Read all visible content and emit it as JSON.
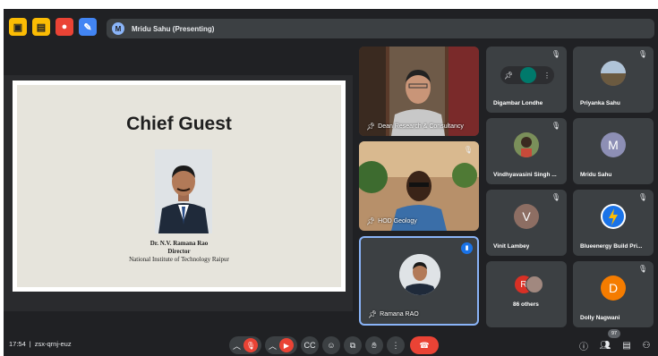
{
  "colors": {
    "background": "#202124",
    "tile": "#3c4043",
    "danger": "#ea4335",
    "accent": "#8ab4f8",
    "active_border": "#8ab4f8"
  },
  "topbar": {
    "icons": [
      {
        "name": "activities-icon",
        "color": "#fbbc04",
        "glyph": "▣"
      },
      {
        "name": "notes-icon",
        "color": "#fbbc04",
        "glyph": "▤"
      },
      {
        "name": "record-icon",
        "color": "#ea4335",
        "glyph": "●"
      },
      {
        "name": "whiteboard-icon",
        "color": "#4285f4",
        "glyph": "✎"
      }
    ],
    "presenter_initial": "M",
    "presenter_label": "Mridu Sahu (Presenting)"
  },
  "slide": {
    "title": "Chief Guest",
    "name": "Dr. N.V. Ramana Rao",
    "role": "Director",
    "institute": "National Institute of Technology Raipur"
  },
  "large_tiles": [
    {
      "name": "Dean Research & Consultancy"
    },
    {
      "name": "HOD Geology"
    },
    {
      "name": "Ramana RAO"
    }
  ],
  "small_tiles": [
    {
      "name": "Digambar Londhe",
      "avatar": "",
      "color": "#00796b"
    },
    {
      "name": "Priyanka Sahu",
      "avatar": "",
      "color": "#8d6e63"
    },
    {
      "name": "Vindhyavasini Singh ...",
      "avatar": "",
      "color": "#6d4c41"
    },
    {
      "name": "Mridu Sahu",
      "avatar": "M",
      "color": "#8d8fb5"
    },
    {
      "name": "Vinit Lambey",
      "avatar": "V",
      "color": "#8d6e63"
    },
    {
      "name": "Blueenergy Build Pri...",
      "avatar": "",
      "color": "#1a73e8"
    },
    {
      "name": "86 others",
      "avatar": "R",
      "color": "#d93025"
    },
    {
      "name": "Dolly Nagwani",
      "avatar": "D",
      "color": "#f57c00"
    }
  ],
  "bottombar": {
    "time": "17:54",
    "separator": "|",
    "meeting_code": "zsx-qrnj-euz",
    "people_count": "97"
  }
}
